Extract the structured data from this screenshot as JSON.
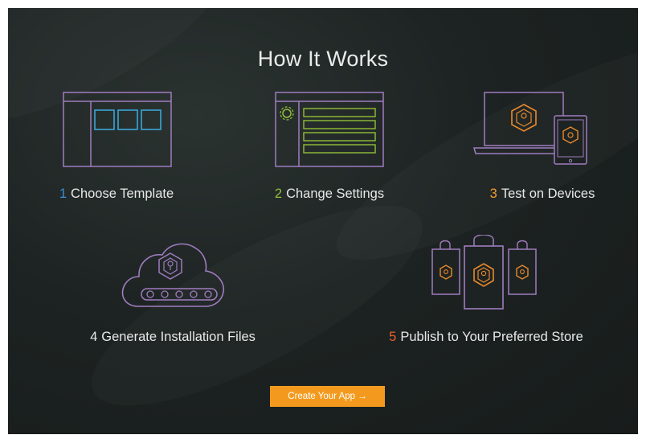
{
  "section": {
    "title": "How It Works"
  },
  "steps": [
    {
      "number": "1",
      "label": "Choose Template",
      "number_color": "#3a8fd6",
      "icon": "template-window-icon"
    },
    {
      "number": "2",
      "label": "Change Settings",
      "number_color": "#93bf3a",
      "icon": "settings-window-icon"
    },
    {
      "number": "3",
      "label": "Test on Devices",
      "number_color": "#f29a2e",
      "icon": "devices-icon"
    },
    {
      "number": "4",
      "label": "Generate Installation Files",
      "number_color": "#e7e9e8",
      "icon": "cloud-build-icon"
    },
    {
      "number": "5",
      "label": "Publish to Your Preferred Store",
      "number_color": "#e8612d",
      "icon": "store-bags-icon"
    }
  ],
  "cta": {
    "label": "Create Your App →",
    "color": "#f39a1e"
  },
  "colors": {
    "background": "#1d2322",
    "outline_purple": "#a07cc0",
    "accent_blue": "#3aa6d8",
    "accent_green": "#93bf3a",
    "accent_orange": "#e98a2c"
  }
}
